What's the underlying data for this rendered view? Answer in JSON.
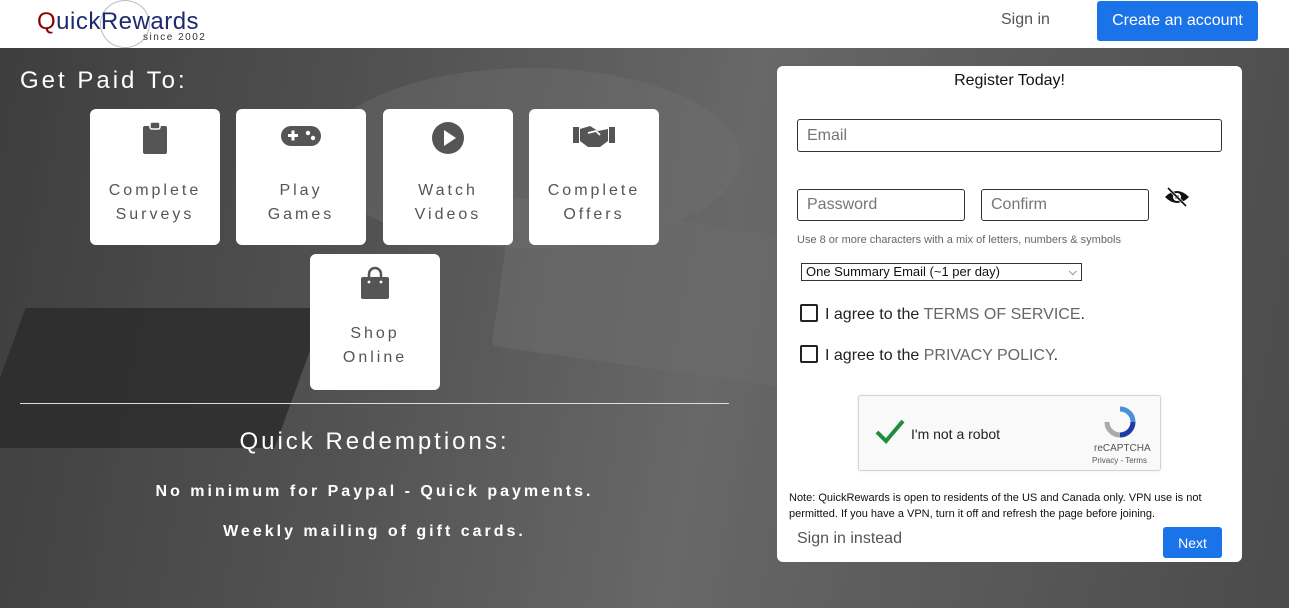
{
  "header": {
    "logo_q": "Q",
    "logo_rest": "uickRewards",
    "logo_sub": "since 2002",
    "sign_in": "Sign in",
    "create_account": "Create an account"
  },
  "hero": {
    "get_paid": "Get Paid To:",
    "tiles": [
      {
        "icon": "clipboard-icon",
        "line1": "Complete",
        "line2": "Surveys"
      },
      {
        "icon": "gamepad-icon",
        "line1": "Play",
        "line2": "Games"
      },
      {
        "icon": "play-circle-icon",
        "line1": "Watch",
        "line2": "Videos"
      },
      {
        "icon": "handshake-icon",
        "line1": "Complete",
        "line2": "Offers"
      },
      {
        "icon": "shopping-bag-icon",
        "line1": "Shop",
        "line2": "Online"
      }
    ],
    "redemptions_title": "Quick Redemptions:",
    "line1": "No minimum for Paypal - Quick payments.",
    "line2": "Weekly mailing of gift cards."
  },
  "register": {
    "title": "Register Today!",
    "email_placeholder": "Email",
    "password_placeholder": "Password",
    "confirm_placeholder": "Confirm",
    "hint": "Use 8 or more characters with a mix of letters, numbers & symbols",
    "email_frequency": "One Summary Email (~1 per day)",
    "terms_prefix": "I agree to the ",
    "terms_link": "TERMS OF SERVICE",
    "privacy_prefix": "I agree to the ",
    "privacy_link": "PRIVACY POLICY",
    "period": ".",
    "captcha_label": "I'm not a robot",
    "captcha_brand": "reCAPTCHA",
    "captcha_links": "Privacy - Terms",
    "note": "Note: QuickRewards is open to residents of the US and Canada only. VPN use is not permitted. If you have a VPN, turn it off and refresh the page before joining.",
    "sign_in_instead": "Sign in instead",
    "next": "Next"
  },
  "colors": {
    "accent": "#1a73e8",
    "tile_icon": "#555555",
    "check_green": "#1e8e3e"
  }
}
